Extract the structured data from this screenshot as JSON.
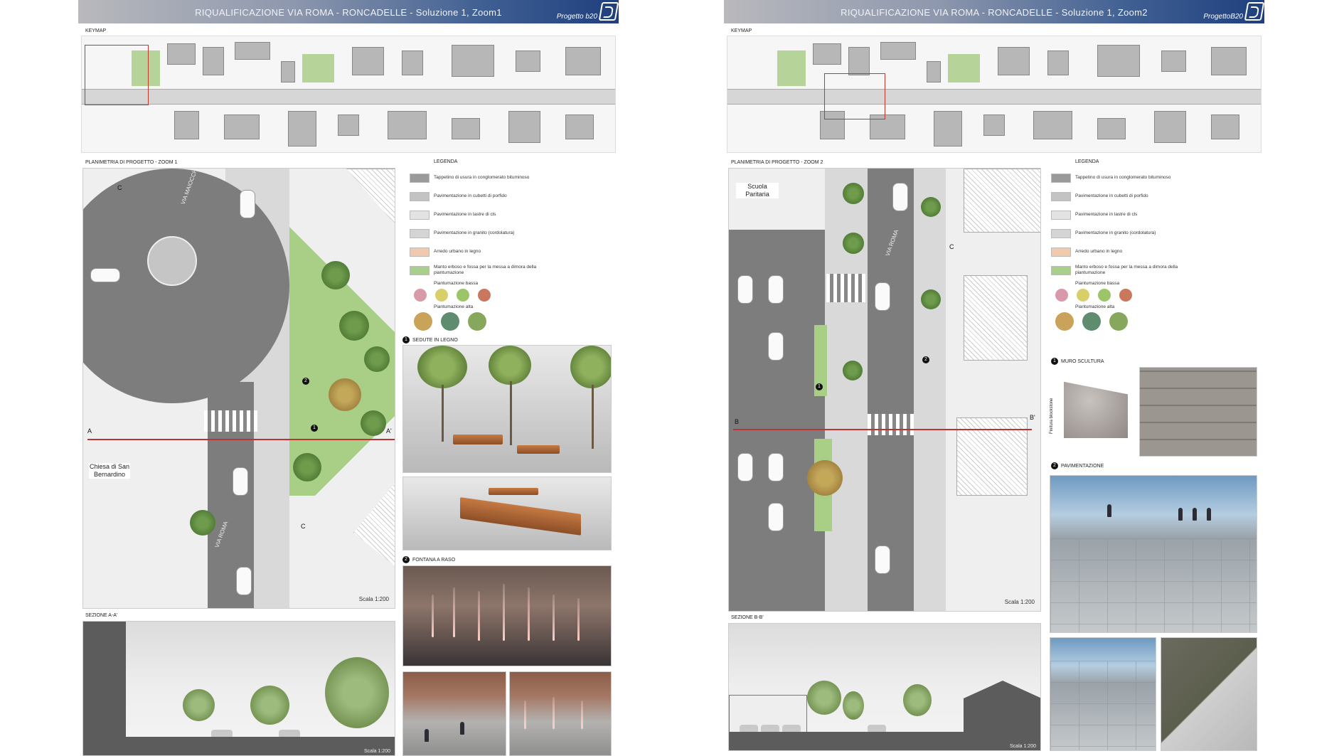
{
  "left": {
    "title": "RIQUALIFICAZIONE VIA ROMA - RONCADELLE - Soluzione 1, Zoom1",
    "brand": "Progetto b20",
    "keymap_label": "KEYMAP",
    "plan_label": "PLANIMETRIA DI PROGETTO - ZOOM 1",
    "plan_tags": {
      "a": "A",
      "a_prime": "A'",
      "c1": "C",
      "c2": "C",
      "n1": "1",
      "n2": "2"
    },
    "street_via_maiocchi": "VIA MAIOCCHI",
    "street_via_roma": "VIA ROMA",
    "church": "Chiesa di San Bernardino",
    "scale": "Scala 1:200",
    "section_label": "SEZIONE A-A'",
    "section_scale": "Scala 1:200",
    "photo1_num": "1",
    "photo1_title": "SEDUTE IN LEGNO",
    "photo2_num": "2",
    "photo2_title": "FONTANA A RASO"
  },
  "right": {
    "title": "RIQUALIFICAZIONE VIA ROMA - RONCADELLE - Soluzione 1, Zoom2",
    "brand": "ProgettoB20",
    "keymap_label": "KEYMAP",
    "plan_label": "PLANIMETRIA DI PROGETTO - ZOOM 2",
    "plan_tags": {
      "b": "B",
      "b_prime": "B'",
      "c": "C",
      "n1": "1",
      "n2": "2"
    },
    "street_via_roma": "VIA ROMA",
    "school": "Scuola Paritaria",
    "scale": "Scala 1:200",
    "section_label": "SEZIONE B-B'",
    "section_scale": "Scala 1:200",
    "photo1_num": "1",
    "photo1_title": "MURO SCULTURA",
    "photo1_caption": "Finitura blockstone",
    "photo2_num": "2",
    "photo2_title": "PAVIMENTAZIONE"
  },
  "legend": {
    "title": "LEGENDA",
    "items": [
      "Tappetino di usura in conglomerato bituminoso",
      "Pavimentazione in cubetti di porfido",
      "Pavimentazione in lastre di cls",
      "Pavimentazione in granito (cordolatura)",
      "Arredo urbano in legno",
      "Manto erboso e fossa per la messa a dimora della piantumazione"
    ],
    "colors": [
      "#9a9a9a",
      "#c3c3c3",
      "#e3e3e3",
      "#d4d4d4",
      "#f1c9ad",
      "#a9d08a"
    ],
    "low_plants": "Piantumazione bassa",
    "high_plants": "Piantumazione alta"
  }
}
